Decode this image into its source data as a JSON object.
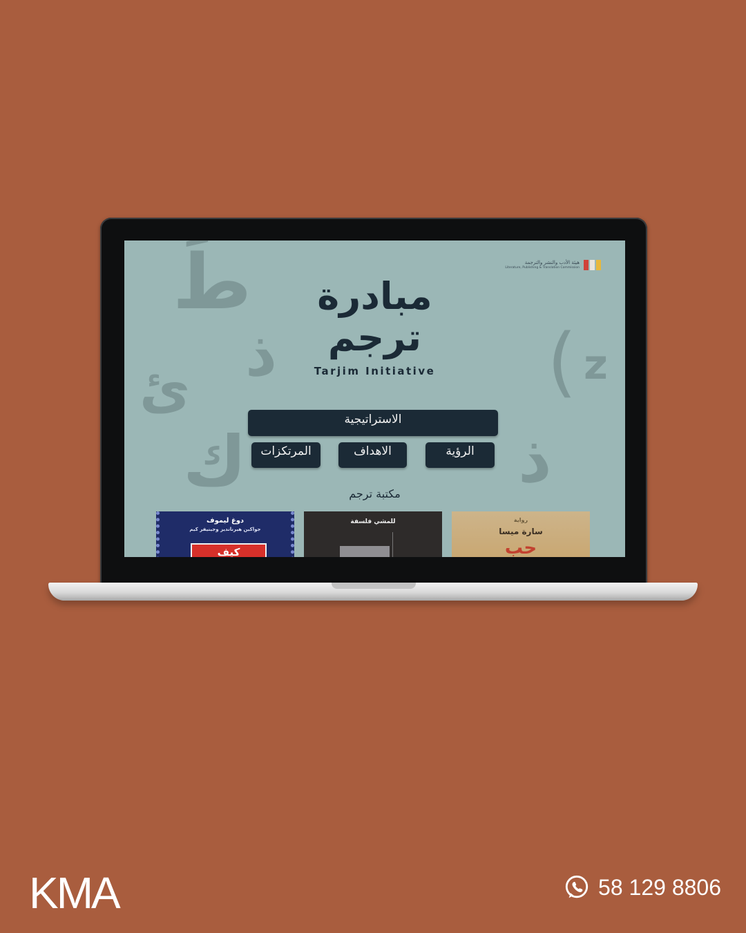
{
  "screen": {
    "logo": {
      "text_ar": "هيئة الأدب والنشر والترجمة",
      "text_en": "Literature, Publishing & Translation Commission",
      "colors": [
        "#d0423a",
        "#e9e4da",
        "#e8b83b"
      ]
    },
    "title_line1": "مبادرة",
    "title_line2": "ترجم",
    "title_en": "Tarjim Initiative",
    "nav": {
      "strategy": "الاستراتيجية",
      "vision": "الرؤية",
      "goals": "الاهداف",
      "pillars": "المرتكزات"
    },
    "library_title": "مكتبة ترجم",
    "books": [
      {
        "line1": "دوغ ليموف",
        "line2": "جواكين هيرنانديز وجينيفر كيم",
        "line3": "كيف"
      },
      {
        "line1": "للمشي فلسفة"
      },
      {
        "line1": "رواية",
        "line2": "سارة ميسا",
        "line3": "حب"
      }
    ],
    "decorative_glyphs": [
      "طَ",
      "ئ",
      "ذ",
      "ك",
      "(",
      "z",
      "ذ"
    ]
  },
  "branding": {
    "logo": "KMA"
  },
  "contact": {
    "icon": "whatsapp-icon",
    "phone": "58 129 8806"
  },
  "colors": {
    "background": "#a95d3e",
    "screen": "#9bb7b6",
    "button": "#1b2a36"
  }
}
